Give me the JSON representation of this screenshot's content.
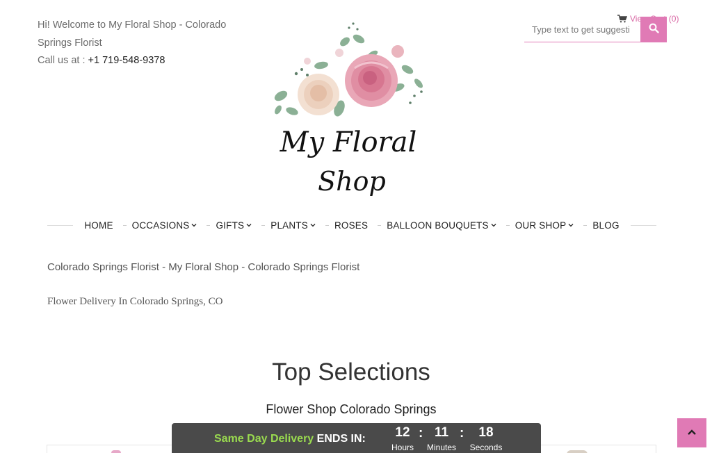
{
  "header": {
    "welcome": "Hi! Welcome to My Floral Shop - Colorado Springs Florist",
    "call_label": "Call us at : ",
    "phone": "+1 719-548-9378",
    "cart_label": "View Cart",
    "cart_count": "(0)",
    "search_placeholder": "Type text to get suggesti",
    "logo_line1": "My Floral",
    "logo_line2": "Shop"
  },
  "nav": {
    "items": [
      {
        "label": "HOME",
        "has_dropdown": false
      },
      {
        "label": "OCCASIONS",
        "has_dropdown": true
      },
      {
        "label": "GIFTS",
        "has_dropdown": true
      },
      {
        "label": "PLANTS",
        "has_dropdown": true
      },
      {
        "label": "ROSES",
        "has_dropdown": false
      },
      {
        "label": "BALLOON BOUQUETS",
        "has_dropdown": true
      },
      {
        "label": "OUR SHOP",
        "has_dropdown": true
      },
      {
        "label": "BLOG",
        "has_dropdown": false
      }
    ]
  },
  "main": {
    "title": "Colorado Springs Florist - My Floral Shop - Colorado Springs Florist",
    "subtitle": "Flower Delivery In Colorado Springs, CO",
    "section_title": "Top Selections",
    "section_subtitle": "Flower Shop Colorado Springs"
  },
  "countdown": {
    "promo_green": "Same Day Delivery",
    "promo_white": "ENDS IN:",
    "hours": "12",
    "minutes": "11",
    "seconds": "18",
    "hours_label": "Hours",
    "minutes_label": "Minutes",
    "seconds_label": "Seconds",
    "separator": ":"
  },
  "colors": {
    "accent": "#e07ab5",
    "countdown_bg": "#4a4a4a",
    "promo_green": "#9adb4f"
  },
  "icons": {
    "cart": "cart-icon",
    "search": "search-icon",
    "scroll_top": "chevron-up-icon",
    "dropdown": "chevron-down-icon"
  }
}
